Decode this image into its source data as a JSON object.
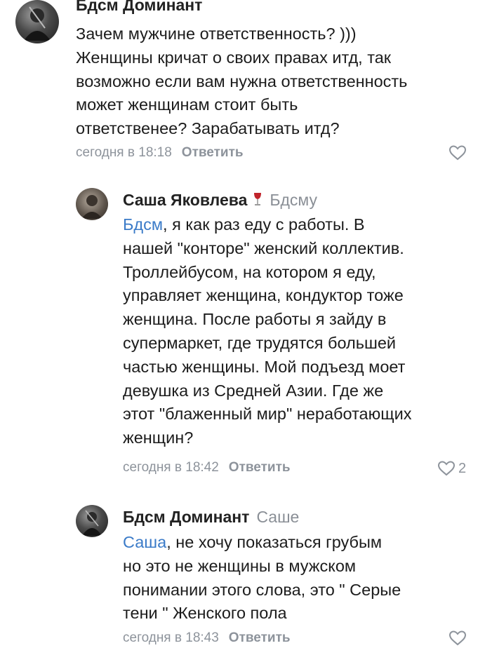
{
  "comments": [
    {
      "author": "Бдсм Доминант",
      "reply_to": "",
      "mention": "",
      "text": "Зачем мужчине ответственность? )))\nЖенщины кричат о своих правах итд, так\nвозможно если вам нужна ответственность\nможет женщинам стоит  быть\nответственее? Зарабатывать итд?",
      "time": "сегодня в 18:18",
      "reply_label": "Ответить",
      "likes": ""
    },
    {
      "author": "Саша Яковлева",
      "reply_to": "Бдсму",
      "mention": "Бдсм",
      "text": ", я как раз еду с работы. В\nнашей \"конторе\" женский коллектив.\nТроллейбусом, на котором я еду,\nуправляет женщина, кондуктор тоже\nженщина. После работы я зайду в\nсупермаркет, где трудятся большей\nчастью женщины. Мой подъезд моет\nдевушка из Средней Азии. Где же\nэтот \"блаженный мир\" неработающих\nженщин?",
      "time": "сегодня в 18:42",
      "reply_label": "Ответить",
      "likes": "2"
    },
    {
      "author": "Бдсм Доминант",
      "reply_to": "Саше",
      "mention": "Саша",
      "text": ", не хочу показаться грубым\nно это не женщины в мужском\nпонимании этого слова, это \" Серые\nтени \" Женского пола",
      "time": "сегодня в 18:43",
      "reply_label": "Ответить",
      "likes": ""
    }
  ],
  "colors": {
    "link": "#3b7bc8",
    "meta": "#8d939b"
  },
  "icons": {
    "like": "heart-outline-icon",
    "badge": "wine-glass-icon"
  }
}
